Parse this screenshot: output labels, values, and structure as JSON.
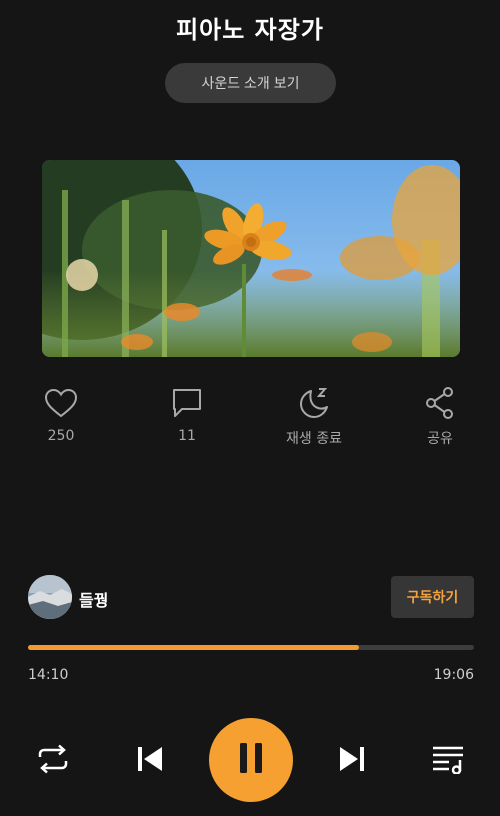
{
  "header": {
    "title": "피아노 자장가",
    "intro_button": "사운드 소개 보기"
  },
  "actions": {
    "like_count": "250",
    "comment_count": "11",
    "sleep_timer_label": "재생 종료",
    "share_label": "공유"
  },
  "artist": {
    "name": "들꿩",
    "subscribe_label": "구독하기"
  },
  "player": {
    "current_time": "14:10",
    "total_time": "19:06",
    "progress": 0.742,
    "state": "playing"
  },
  "colors": {
    "accent": "#f7a032",
    "background": "#151515"
  },
  "icons": {
    "like": "heart-icon",
    "comment": "comment-icon",
    "sleep": "moon-zz-icon",
    "share": "share-icon",
    "repeat": "repeat-icon",
    "prev": "skip-previous-icon",
    "pause": "pause-icon",
    "next": "skip-next-icon",
    "playlist": "playlist-icon"
  }
}
